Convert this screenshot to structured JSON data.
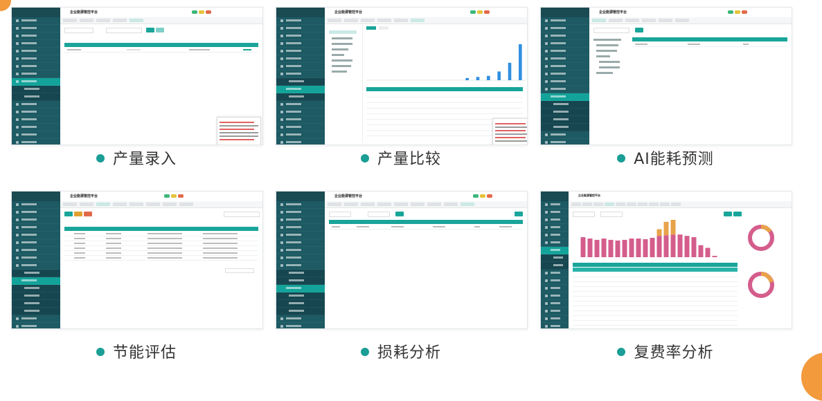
{
  "page": {
    "captions": [
      "产量录入",
      "产量比较",
      "AI能耗预测",
      "节能评估",
      "损耗分析",
      "复费率分析"
    ]
  },
  "app": {
    "title": "企业能源管控平台"
  },
  "colors": {
    "accent": "#1a9e96",
    "sidebar": "#1d5a63",
    "corner": "#f29a3c",
    "bar_pink": "#d45d8c",
    "bar_orange": "#e8a24a",
    "bar_blue": "#2f8fe0"
  },
  "compare_chart": {
    "values": [
      0,
      0,
      0,
      0,
      0,
      0,
      0,
      0,
      0,
      2,
      3,
      4,
      8,
      16,
      33
    ]
  },
  "rate_chart": {
    "series": [
      {
        "values": [
          30,
          28,
          26,
          28,
          26,
          25,
          26,
          28,
          28,
          27,
          29,
          32,
          33,
          34,
          34,
          32,
          30,
          18,
          14,
          2
        ]
      },
      {
        "values": [
          0,
          0,
          0,
          0,
          0,
          0,
          0,
          0,
          0,
          0,
          0,
          10,
          20,
          22,
          0,
          0,
          0,
          0,
          0,
          0
        ]
      }
    ]
  }
}
